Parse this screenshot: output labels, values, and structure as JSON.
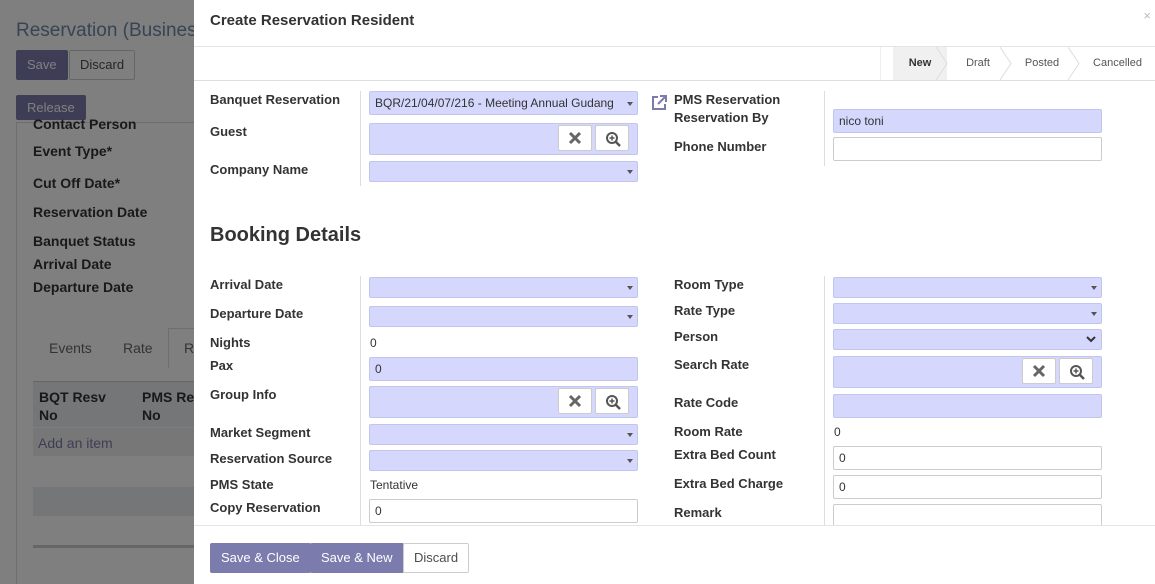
{
  "background": {
    "title": "Reservation (Business",
    "save_label": "Save",
    "discard_label": "Discard",
    "release_label": "Release",
    "fields": [
      "Contact Person",
      "Event Type*",
      "Cut Off Date*",
      "Reservation Date",
      "Banquet Status",
      "Arrival Date",
      "Departure Date"
    ],
    "tabs": [
      "Events",
      "Rate",
      "R"
    ],
    "table_headers": [
      "BQT Resv\nNo",
      "PMS Res\nNo"
    ],
    "add_item": "Add an item"
  },
  "modal": {
    "title": "Create Reservation Resident",
    "close_glyph": "×",
    "statusbar": [
      "New",
      "Draft",
      "Posted",
      "Cancelled"
    ],
    "active_stage": "New"
  },
  "header_fields": {
    "banquet_reservation_label": "Banquet Reservation",
    "banquet_reservation_value": "BQR/21/04/07/216 - Meeting Annual Gudang",
    "guest_label": "Guest",
    "company_name_label": "Company Name",
    "pms_reservation_label": "PMS Reservation",
    "reservation_by_label": "Reservation By",
    "reservation_by_value": "nico toni",
    "phone_number_label": "Phone Number",
    "phone_number_value": ""
  },
  "booking": {
    "section_title": "Booking Details",
    "left": {
      "arrival_date_label": "Arrival Date",
      "departure_date_label": "Departure Date",
      "nights_label": "Nights",
      "nights_value": "0",
      "pax_label": "Pax",
      "pax_value": "0",
      "group_info_label": "Group Info",
      "market_segment_label": "Market Segment",
      "reservation_source_label": "Reservation Source",
      "pms_state_label": "PMS State",
      "pms_state_value": "Tentative",
      "copy_reservation_label": "Copy Reservation",
      "copy_reservation_value": "0"
    },
    "right": {
      "room_type_label": "Room Type",
      "rate_type_label": "Rate Type",
      "person_label": "Person",
      "search_rate_label": "Search Rate",
      "rate_code_label": "Rate Code",
      "room_rate_label": "Room Rate",
      "room_rate_value": "0",
      "extra_bed_count_label": "Extra Bed Count",
      "extra_bed_count_value": "0",
      "extra_bed_charge_label": "Extra Bed Charge",
      "extra_bed_charge_value": "0",
      "remark_label": "Remark"
    }
  },
  "footer": {
    "save_close_label": "Save & Close",
    "save_new_label": "Save & New",
    "discard_label": "Discard"
  },
  "colors": {
    "primary": "#7c7bad",
    "required_input": "#d5d7fd",
    "overlay": "rgba(0,0,0,0.5)"
  }
}
